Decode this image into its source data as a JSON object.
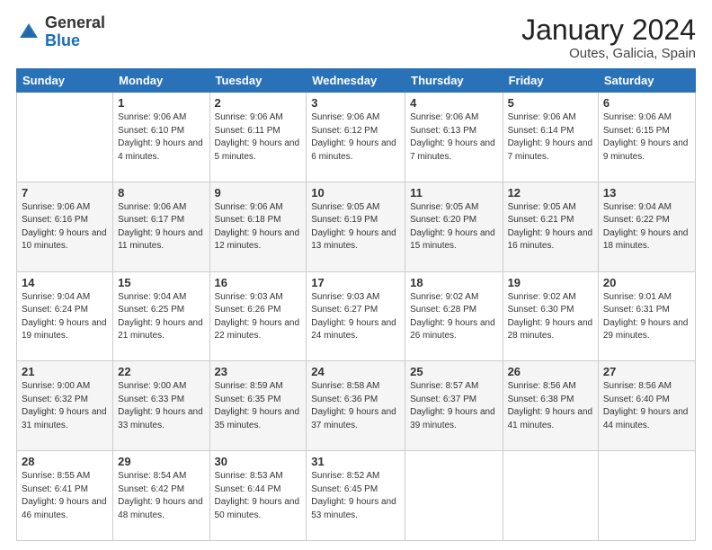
{
  "logo": {
    "general": "General",
    "blue": "Blue"
  },
  "header": {
    "month_year": "January 2024",
    "location": "Outes, Galicia, Spain"
  },
  "weekdays": [
    "Sunday",
    "Monday",
    "Tuesday",
    "Wednesday",
    "Thursday",
    "Friday",
    "Saturday"
  ],
  "weeks": [
    [
      {
        "day": "",
        "sunrise": "",
        "sunset": "",
        "daylight": ""
      },
      {
        "day": "1",
        "sunrise": "Sunrise: 9:06 AM",
        "sunset": "Sunset: 6:10 PM",
        "daylight": "Daylight: 9 hours and 4 minutes."
      },
      {
        "day": "2",
        "sunrise": "Sunrise: 9:06 AM",
        "sunset": "Sunset: 6:11 PM",
        "daylight": "Daylight: 9 hours and 5 minutes."
      },
      {
        "day": "3",
        "sunrise": "Sunrise: 9:06 AM",
        "sunset": "Sunset: 6:12 PM",
        "daylight": "Daylight: 9 hours and 6 minutes."
      },
      {
        "day": "4",
        "sunrise": "Sunrise: 9:06 AM",
        "sunset": "Sunset: 6:13 PM",
        "daylight": "Daylight: 9 hours and 7 minutes."
      },
      {
        "day": "5",
        "sunrise": "Sunrise: 9:06 AM",
        "sunset": "Sunset: 6:14 PM",
        "daylight": "Daylight: 9 hours and 7 minutes."
      },
      {
        "day": "6",
        "sunrise": "Sunrise: 9:06 AM",
        "sunset": "Sunset: 6:15 PM",
        "daylight": "Daylight: 9 hours and 9 minutes."
      }
    ],
    [
      {
        "day": "7",
        "sunrise": "Sunrise: 9:06 AM",
        "sunset": "Sunset: 6:16 PM",
        "daylight": "Daylight: 9 hours and 10 minutes."
      },
      {
        "day": "8",
        "sunrise": "Sunrise: 9:06 AM",
        "sunset": "Sunset: 6:17 PM",
        "daylight": "Daylight: 9 hours and 11 minutes."
      },
      {
        "day": "9",
        "sunrise": "Sunrise: 9:06 AM",
        "sunset": "Sunset: 6:18 PM",
        "daylight": "Daylight: 9 hours and 12 minutes."
      },
      {
        "day": "10",
        "sunrise": "Sunrise: 9:05 AM",
        "sunset": "Sunset: 6:19 PM",
        "daylight": "Daylight: 9 hours and 13 minutes."
      },
      {
        "day": "11",
        "sunrise": "Sunrise: 9:05 AM",
        "sunset": "Sunset: 6:20 PM",
        "daylight": "Daylight: 9 hours and 15 minutes."
      },
      {
        "day": "12",
        "sunrise": "Sunrise: 9:05 AM",
        "sunset": "Sunset: 6:21 PM",
        "daylight": "Daylight: 9 hours and 16 minutes."
      },
      {
        "day": "13",
        "sunrise": "Sunrise: 9:04 AM",
        "sunset": "Sunset: 6:22 PM",
        "daylight": "Daylight: 9 hours and 18 minutes."
      }
    ],
    [
      {
        "day": "14",
        "sunrise": "Sunrise: 9:04 AM",
        "sunset": "Sunset: 6:24 PM",
        "daylight": "Daylight: 9 hours and 19 minutes."
      },
      {
        "day": "15",
        "sunrise": "Sunrise: 9:04 AM",
        "sunset": "Sunset: 6:25 PM",
        "daylight": "Daylight: 9 hours and 21 minutes."
      },
      {
        "day": "16",
        "sunrise": "Sunrise: 9:03 AM",
        "sunset": "Sunset: 6:26 PM",
        "daylight": "Daylight: 9 hours and 22 minutes."
      },
      {
        "day": "17",
        "sunrise": "Sunrise: 9:03 AM",
        "sunset": "Sunset: 6:27 PM",
        "daylight": "Daylight: 9 hours and 24 minutes."
      },
      {
        "day": "18",
        "sunrise": "Sunrise: 9:02 AM",
        "sunset": "Sunset: 6:28 PM",
        "daylight": "Daylight: 9 hours and 26 minutes."
      },
      {
        "day": "19",
        "sunrise": "Sunrise: 9:02 AM",
        "sunset": "Sunset: 6:30 PM",
        "daylight": "Daylight: 9 hours and 28 minutes."
      },
      {
        "day": "20",
        "sunrise": "Sunrise: 9:01 AM",
        "sunset": "Sunset: 6:31 PM",
        "daylight": "Daylight: 9 hours and 29 minutes."
      }
    ],
    [
      {
        "day": "21",
        "sunrise": "Sunrise: 9:00 AM",
        "sunset": "Sunset: 6:32 PM",
        "daylight": "Daylight: 9 hours and 31 minutes."
      },
      {
        "day": "22",
        "sunrise": "Sunrise: 9:00 AM",
        "sunset": "Sunset: 6:33 PM",
        "daylight": "Daylight: 9 hours and 33 minutes."
      },
      {
        "day": "23",
        "sunrise": "Sunrise: 8:59 AM",
        "sunset": "Sunset: 6:35 PM",
        "daylight": "Daylight: 9 hours and 35 minutes."
      },
      {
        "day": "24",
        "sunrise": "Sunrise: 8:58 AM",
        "sunset": "Sunset: 6:36 PM",
        "daylight": "Daylight: 9 hours and 37 minutes."
      },
      {
        "day": "25",
        "sunrise": "Sunrise: 8:57 AM",
        "sunset": "Sunset: 6:37 PM",
        "daylight": "Daylight: 9 hours and 39 minutes."
      },
      {
        "day": "26",
        "sunrise": "Sunrise: 8:56 AM",
        "sunset": "Sunset: 6:38 PM",
        "daylight": "Daylight: 9 hours and 41 minutes."
      },
      {
        "day": "27",
        "sunrise": "Sunrise: 8:56 AM",
        "sunset": "Sunset: 6:40 PM",
        "daylight": "Daylight: 9 hours and 44 minutes."
      }
    ],
    [
      {
        "day": "28",
        "sunrise": "Sunrise: 8:55 AM",
        "sunset": "Sunset: 6:41 PM",
        "daylight": "Daylight: 9 hours and 46 minutes."
      },
      {
        "day": "29",
        "sunrise": "Sunrise: 8:54 AM",
        "sunset": "Sunset: 6:42 PM",
        "daylight": "Daylight: 9 hours and 48 minutes."
      },
      {
        "day": "30",
        "sunrise": "Sunrise: 8:53 AM",
        "sunset": "Sunset: 6:44 PM",
        "daylight": "Daylight: 9 hours and 50 minutes."
      },
      {
        "day": "31",
        "sunrise": "Sunrise: 8:52 AM",
        "sunset": "Sunset: 6:45 PM",
        "daylight": "Daylight: 9 hours and 53 minutes."
      },
      {
        "day": "",
        "sunrise": "",
        "sunset": "",
        "daylight": ""
      },
      {
        "day": "",
        "sunrise": "",
        "sunset": "",
        "daylight": ""
      },
      {
        "day": "",
        "sunrise": "",
        "sunset": "",
        "daylight": ""
      }
    ]
  ]
}
